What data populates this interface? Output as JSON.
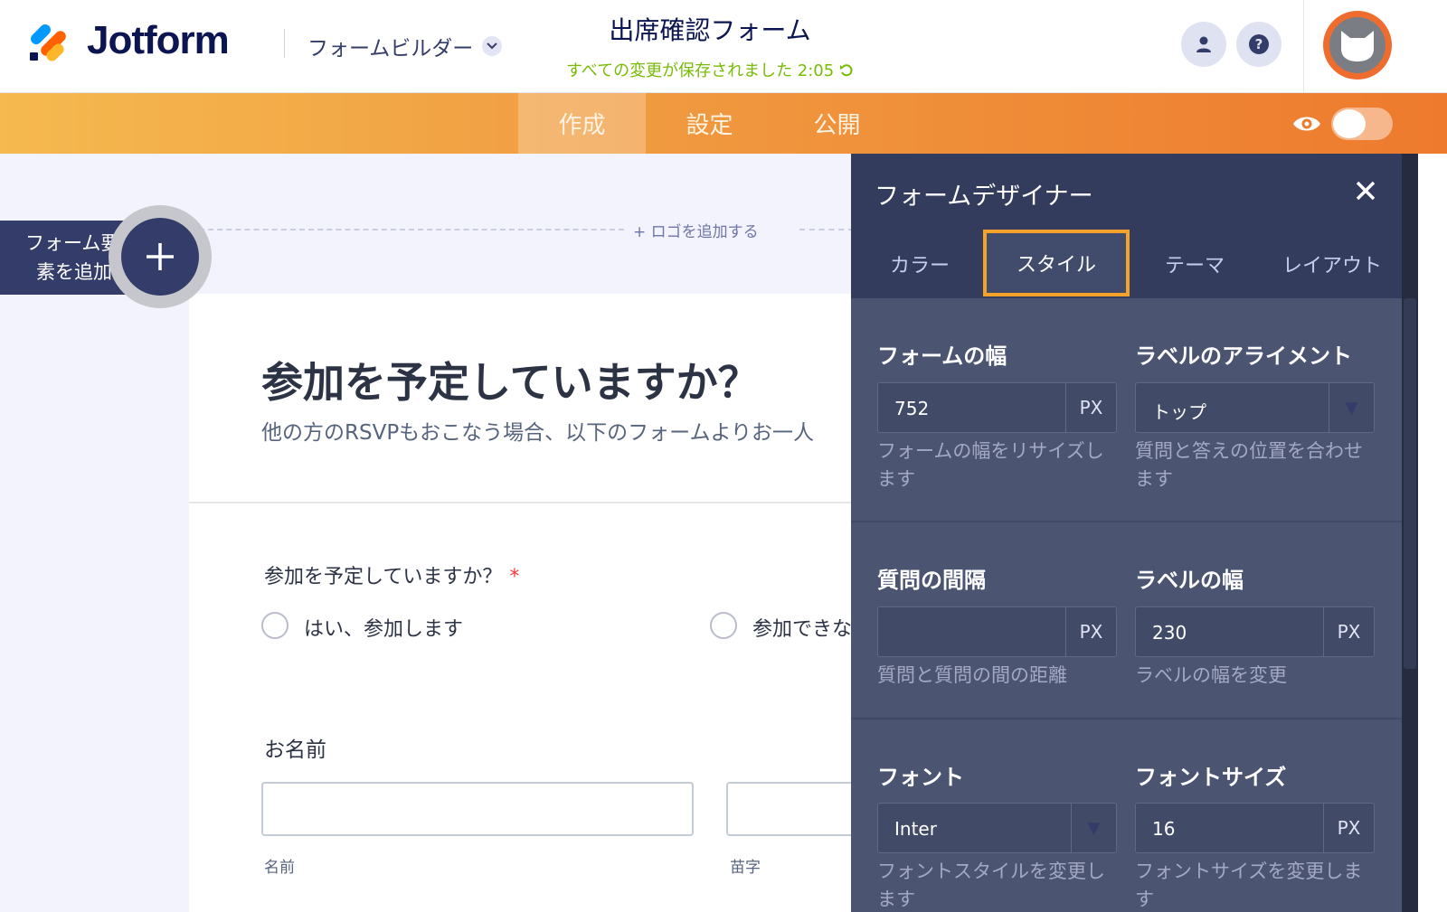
{
  "header": {
    "brand": "Jotform",
    "builder_menu": "フォームビルダー",
    "form_title": "出席確認フォーム",
    "save_status": "すべての変更が保存されました 2:05"
  },
  "nav": {
    "tabs": [
      {
        "label": "作成",
        "active": true
      },
      {
        "label": "設定",
        "active": false
      },
      {
        "label": "公開",
        "active": false
      }
    ],
    "preview_toggle_on": false
  },
  "canvas": {
    "add_logo": "+ ロゴを追加する",
    "add_element_line1": "フォーム要",
    "add_element_line2": "素を追加",
    "heading": "参加を予定していますか？",
    "subheading": "他の方のRSVPもおこなう場合、以下のフォームよりお一人",
    "question": {
      "label": "参加を予定していますか？",
      "required_mark": "*",
      "options": [
        "はい、参加します",
        "参加できな"
      ]
    },
    "name_field": {
      "label": "お名前",
      "first_sublabel": "名前",
      "last_sublabel": "苗字"
    }
  },
  "designer": {
    "title": "フォームデザイナー",
    "tabs": [
      {
        "label": "カラー",
        "active": false
      },
      {
        "label": "スタイル",
        "active": true
      },
      {
        "label": "テーマ",
        "active": false
      },
      {
        "label": "レイアウト",
        "active": false
      }
    ],
    "form_width": {
      "title": "フォームの幅",
      "value": "752",
      "unit": "PX",
      "help": "フォームの幅をリサイズします"
    },
    "label_alignment": {
      "title": "ラベルのアライメント",
      "value": "トップ",
      "help": "質問と答えの位置を合わせます"
    },
    "question_spacing": {
      "title": "質問の間隔",
      "value": "",
      "unit": "PX",
      "help": "質問と質問の間の距離"
    },
    "label_width": {
      "title": "ラベルの幅",
      "value": "230",
      "unit": "PX",
      "help": "ラベルの幅を変更"
    },
    "font": {
      "title": "フォント",
      "value": "Inter",
      "help": "フォントスタイルを変更します"
    },
    "font_size": {
      "title": "フォントサイズ",
      "value": "16",
      "unit": "PX",
      "help": "フォントサイズを変更します"
    }
  },
  "colors": {
    "nav_gradient_start": "#f5b94f",
    "nav_gradient_end": "#ee7a2e",
    "active_tab_outline": "#f5a22a",
    "panel_bg": "#4b5572",
    "save_status": "#78bb07",
    "required": "#f23a3c"
  }
}
